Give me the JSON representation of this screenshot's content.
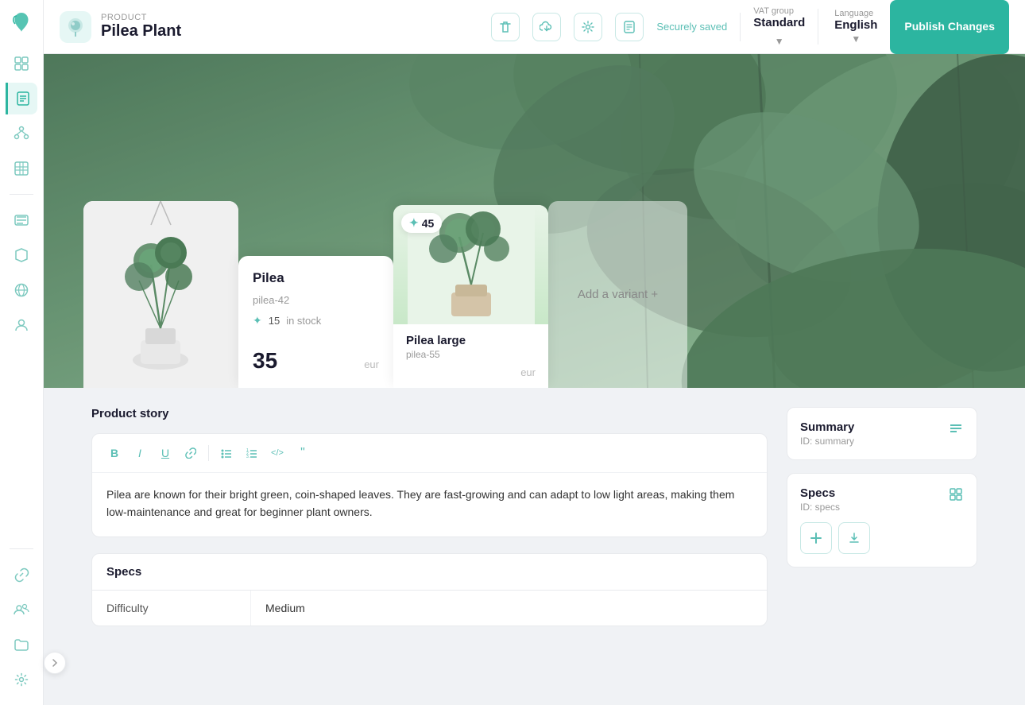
{
  "sidebar": {
    "logo_icon": "🌿",
    "items": [
      {
        "id": "dashboard",
        "icon": "⊞",
        "active": false
      },
      {
        "id": "pages",
        "icon": "▣",
        "active": true
      },
      {
        "id": "components",
        "icon": "⬡",
        "active": false
      },
      {
        "id": "grid",
        "icon": "⊠",
        "active": false
      },
      {
        "id": "list",
        "icon": "≡",
        "active": false
      },
      {
        "id": "box",
        "icon": "⬡",
        "active": false
      },
      {
        "id": "globe",
        "icon": "◉",
        "active": false
      },
      {
        "id": "user",
        "icon": "👤",
        "active": false
      }
    ],
    "bottom_items": [
      {
        "id": "link",
        "icon": "🔗"
      },
      {
        "id": "team",
        "icon": "👥"
      },
      {
        "id": "folder",
        "icon": "📁"
      },
      {
        "id": "settings",
        "icon": "⚙️"
      }
    ]
  },
  "topbar": {
    "product_label": "Product",
    "product_title": "Pilea Plant",
    "product_icon": "🐻",
    "delete_icon": "🗑",
    "cloud_icon": "☁",
    "settings_icon": "⚙",
    "save_icon": "≡",
    "saved_status": "Securely saved",
    "vat_label": "VAT group",
    "vat_value": "Standard",
    "language_label": "Language",
    "language_value": "English",
    "publish_label": "Publish Changes"
  },
  "product": {
    "variant1": {
      "name": "Pilea",
      "sku": "pilea-42",
      "stock": "15",
      "stock_label": "in stock",
      "price": "35",
      "currency": "eur"
    },
    "variant2": {
      "name": "Pilea large",
      "sku": "pilea-55",
      "badge": "45",
      "currency": "eur"
    },
    "add_variant_label": "Add a variant +"
  },
  "product_story": {
    "section_title": "Product story",
    "content": "Pilea are known for their bright green, coin-shaped leaves. They are fast-growing and can adapt to low light areas, making them low-maintenance and great for beginner plant owners."
  },
  "specs": {
    "section_title": "Specs",
    "rows": [
      {
        "key": "Difficulty",
        "value": "Medium"
      }
    ]
  },
  "summary_card": {
    "title": "Summary",
    "id": "ID: summary"
  },
  "specs_card": {
    "title": "Specs",
    "id": "ID: specs"
  },
  "toolbar": {
    "bold": "B",
    "italic": "I",
    "underline": "U",
    "link": "🔗",
    "ul": "≡",
    "ol": "#",
    "code": "</>",
    "quote": "❝"
  }
}
